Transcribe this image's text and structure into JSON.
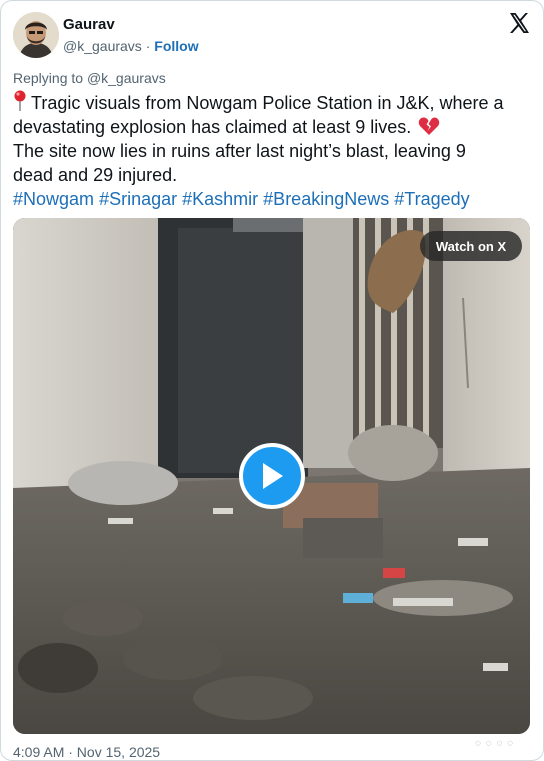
{
  "author": {
    "name": "Gaurav",
    "handle": "@k_gauravs",
    "separator": "·",
    "follow_label": "Follow"
  },
  "reply": {
    "prefix": "Replying to",
    "handle": "@k_gauravs"
  },
  "tweet": {
    "line1": "Tragic visuals from Nowgam Police Station in J&K, where a",
    "line2": "devastating explosion has claimed at least 9 lives.",
    "line3": "The site now lies in ruins after last night’s blast, leaving 9",
    "line4": "dead and 29 injured.",
    "hashtags": [
      "#Nowgam",
      "#Srinagar",
      "#Kashmir",
      "#BreakingNews",
      "#Tragedy"
    ]
  },
  "media": {
    "watch_label": "Watch on X"
  },
  "timestamp": "4:09 AM · Nov 15, 2025",
  "colors": {
    "link": "#1d6fb8",
    "play_button": "#1d9bf0",
    "secondary_text": "#536471"
  }
}
